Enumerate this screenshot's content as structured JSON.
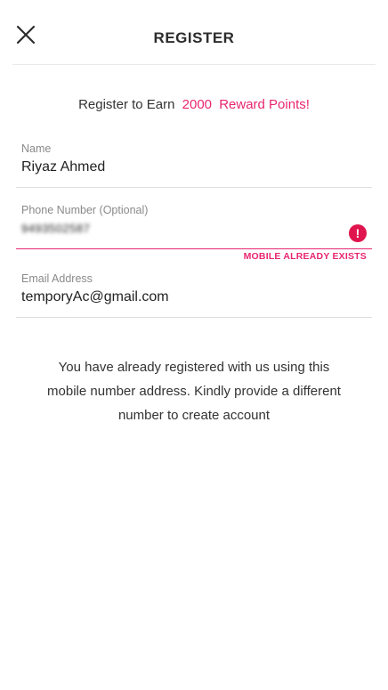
{
  "header": {
    "title": "REGISTER",
    "close_icon": "close-icon"
  },
  "promo": {
    "prefix": "Register to Earn",
    "points": "2000",
    "suffix": "Reward Points!",
    "accent_color": "#e8256f"
  },
  "form": {
    "name": {
      "label": "Name",
      "value": "Riyaz Ahmed"
    },
    "phone": {
      "label": "Phone Number (Optional)",
      "value": "9493502587",
      "error": "MOBILE ALREADY EXISTS",
      "error_icon": "error-icon"
    },
    "email": {
      "label": "Email Address",
      "value": "temporyAc@gmail.com"
    }
  },
  "message": "You have already registered with us using this mobile number address. Kindly provide a different number to create account"
}
